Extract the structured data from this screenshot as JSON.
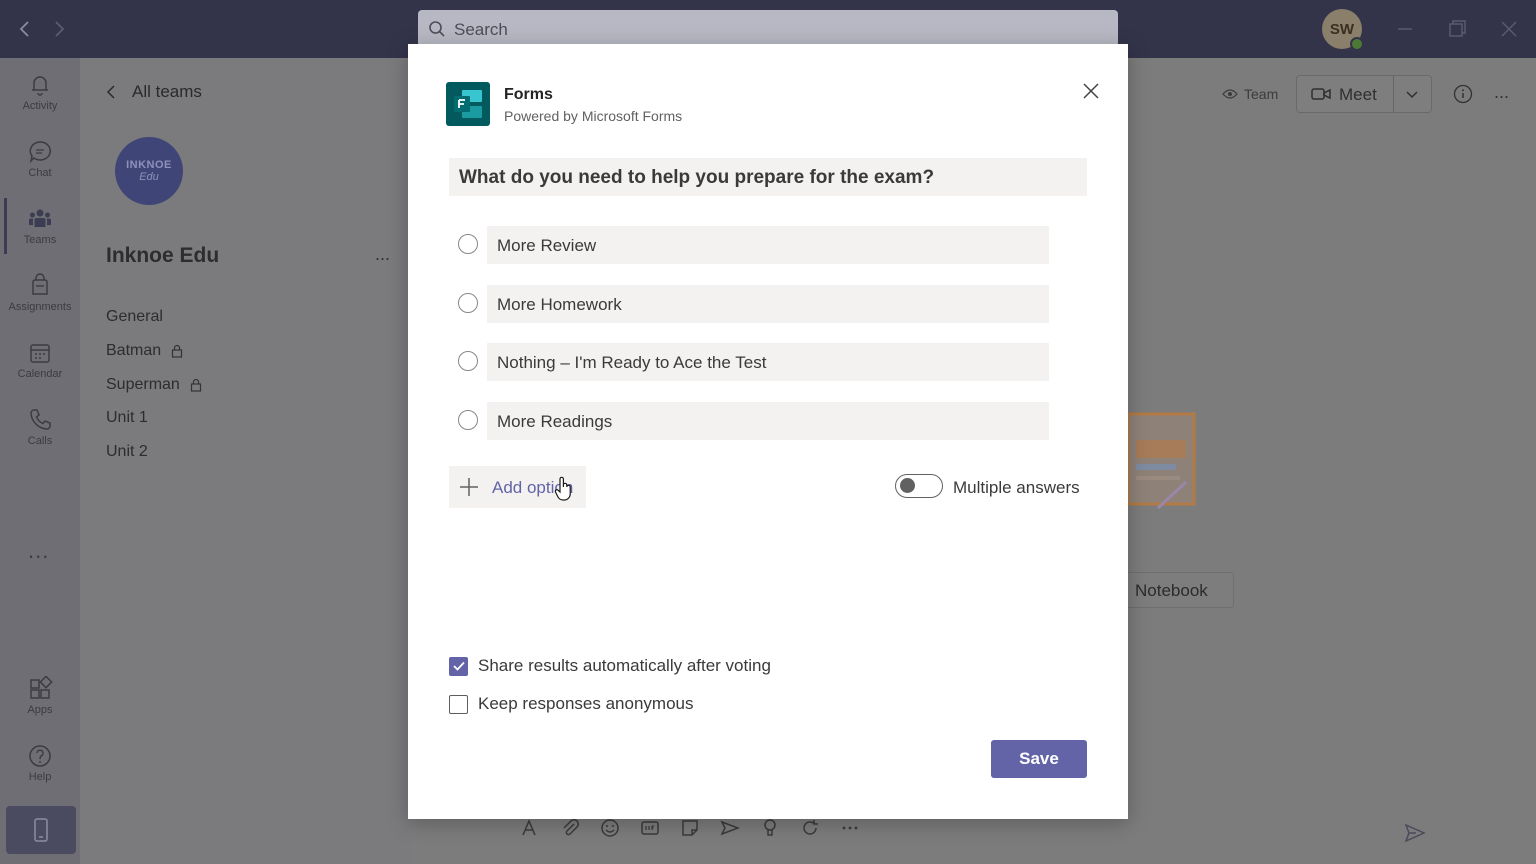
{
  "search": {
    "placeholder": "Search"
  },
  "user": {
    "initials": "SW"
  },
  "rail": {
    "items": [
      {
        "label": "Activity",
        "icon": "bell-icon"
      },
      {
        "label": "Chat",
        "icon": "chat-icon"
      },
      {
        "label": "Teams",
        "icon": "teams-icon"
      },
      {
        "label": "Assignments",
        "icon": "assignments-icon"
      },
      {
        "label": "Calendar",
        "icon": "calendar-icon"
      },
      {
        "label": "Calls",
        "icon": "phone-icon"
      }
    ],
    "more": "...",
    "bottom_items": [
      {
        "label": "Apps",
        "icon": "apps-icon"
      },
      {
        "label": "Help",
        "icon": "help-icon"
      }
    ]
  },
  "team_panel": {
    "back_label": "All teams",
    "logo_line1": "INKNOE",
    "logo_line2": "Edu",
    "team_name": "Inknoe Edu",
    "more": "...",
    "channels": [
      {
        "name": "General",
        "private": false
      },
      {
        "name": "Batman",
        "private": true
      },
      {
        "name": "Superman",
        "private": true
      },
      {
        "name": "Unit 1",
        "private": false
      },
      {
        "name": "Unit 2",
        "private": false
      }
    ]
  },
  "header": {
    "team_label": "Team",
    "meet_label": "Meet",
    "more": "..."
  },
  "background": {
    "notebook_label": "Notebook"
  },
  "modal": {
    "app_name": "Forms",
    "app_subtitle": "Powered by Microsoft Forms",
    "question": "What do you need to help you prepare for the exam?",
    "options": [
      "More Review",
      "More Homework",
      "Nothing – I'm Ready to Ace the Test",
      "More Readings"
    ],
    "add_option_label": "Add option",
    "multiple_answers_label": "Multiple answers",
    "multiple_answers_on": false,
    "share_results_label": "Share results automatically after voting",
    "share_results_checked": true,
    "anonymous_label": "Keep responses anonymous",
    "anonymous_checked": false,
    "save_label": "Save"
  },
  "colors": {
    "accent": "#6264a7",
    "titlebar": "#33344a",
    "forms_brand": "#035a5e"
  }
}
